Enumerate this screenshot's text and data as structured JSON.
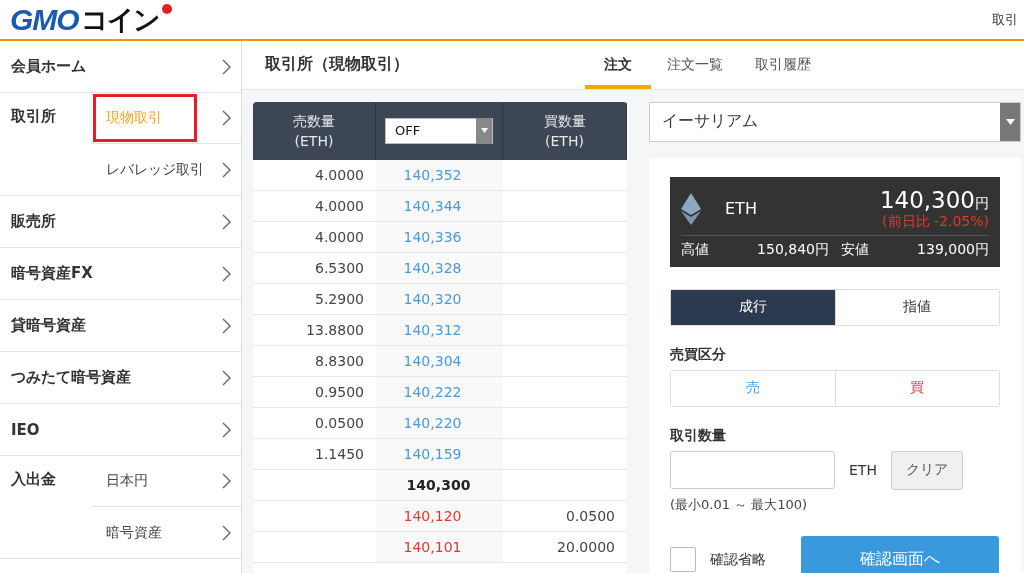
{
  "header": {
    "logo_text": "GMO",
    "logo_kana": "コイン",
    "link": "取引"
  },
  "sidebar": {
    "items": [
      {
        "label": "会員ホーム"
      },
      {
        "label": "取引所",
        "children": [
          {
            "label": "現物取引",
            "selected": true
          },
          {
            "label": "レバレッジ取引",
            "selected": false
          }
        ]
      },
      {
        "label": "販売所"
      },
      {
        "label": "暗号資産FX"
      },
      {
        "label": "貸暗号資産"
      },
      {
        "label": "つみたて暗号資産"
      },
      {
        "label": "IEO"
      },
      {
        "label": "入出金",
        "children": [
          {
            "label": "日本円",
            "selected": false
          },
          {
            "label": "暗号資産",
            "selected": false
          }
        ]
      }
    ]
  },
  "page_title": "取引所（現物取引）",
  "tabs": [
    {
      "label": "注文",
      "selected": true
    },
    {
      "label": "注文一覧",
      "selected": false
    },
    {
      "label": "取引履歴",
      "selected": false
    }
  ],
  "order_book": {
    "columns": [
      "売数量\n(ETH)",
      "買数量\n(ETH)"
    ],
    "filter": "OFF",
    "rows": [
      {
        "kind": "ask",
        "sell_qty": "4.0000",
        "price": "140,352"
      },
      {
        "kind": "ask",
        "sell_qty": "4.0000",
        "price": "140,344"
      },
      {
        "kind": "ask",
        "sell_qty": "4.0000",
        "price": "140,336"
      },
      {
        "kind": "ask",
        "sell_qty": "6.5300",
        "price": "140,328"
      },
      {
        "kind": "ask",
        "sell_qty": "5.2900",
        "price": "140,320"
      },
      {
        "kind": "ask",
        "sell_qty": "13.8800",
        "price": "140,312"
      },
      {
        "kind": "ask",
        "sell_qty": "8.8300",
        "price": "140,304"
      },
      {
        "kind": "ask",
        "sell_qty": "0.9500",
        "price": "140,222"
      },
      {
        "kind": "ask",
        "sell_qty": "0.0500",
        "price": "140,220"
      },
      {
        "kind": "ask",
        "sell_qty": "1.1450",
        "price": "140,159"
      },
      {
        "kind": "mid",
        "price": "140,300"
      },
      {
        "kind": "bid",
        "price": "140,120",
        "buy_qty": "0.0500"
      },
      {
        "kind": "bid",
        "price": "140,101",
        "buy_qty": "20.0000"
      }
    ]
  },
  "currency_select": "イーサリアム",
  "ticker": {
    "symbol": "ETH",
    "price": "140,300",
    "unit": "円",
    "change": "(前日比 -2.05%)",
    "high_label": "高値",
    "high": "150,840円",
    "low_label": "安値",
    "low": "139,000円"
  },
  "order_types": [
    {
      "label": "成行",
      "selected": true
    },
    {
      "label": "指値",
      "selected": false
    }
  ],
  "side_label": "売買区分",
  "sides": [
    {
      "label": "売",
      "kind": "sell"
    },
    {
      "label": "買",
      "kind": "buy"
    }
  ],
  "amount_label": "取引数量",
  "amount_unit": "ETH",
  "clear_button": "クリア",
  "amount_hint": "(最小0.01 ～ 最大100)",
  "skip_confirm": {
    "label": "確認省略",
    "checked": false
  },
  "confirm_button": "確認画面へ"
}
